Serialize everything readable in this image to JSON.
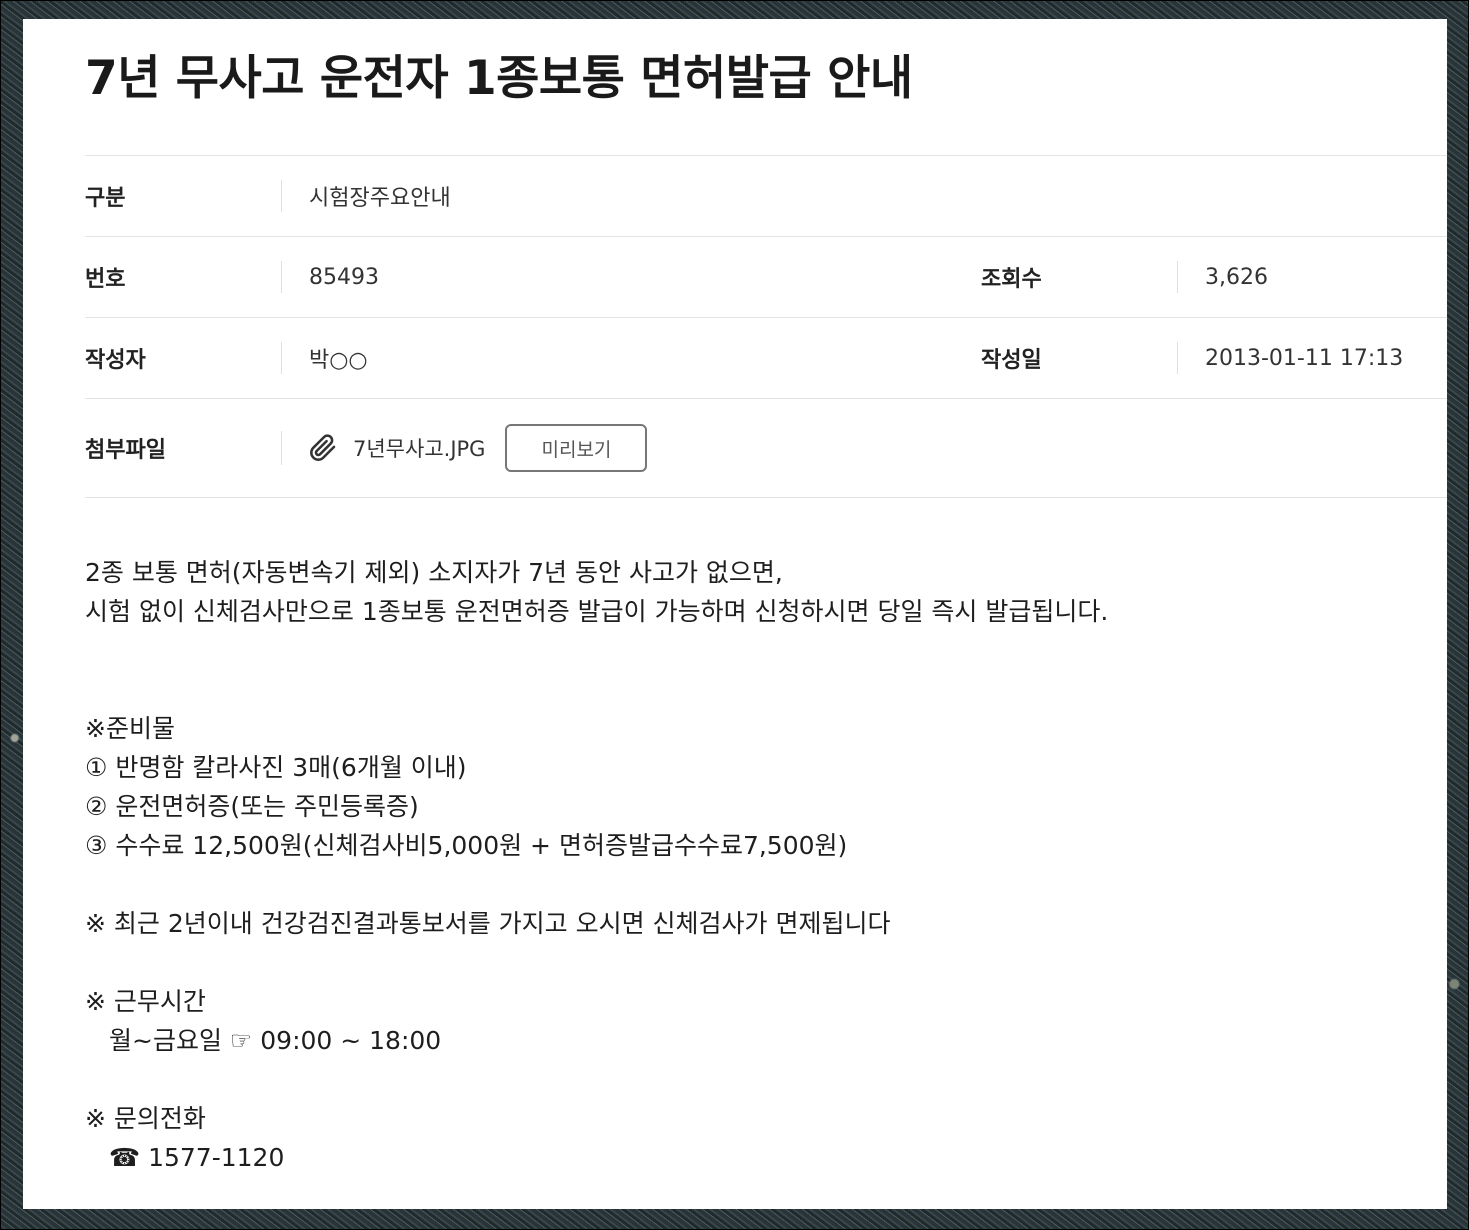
{
  "post": {
    "title": "7년 무사고 운전자 1종보통 면허발급 안내"
  },
  "meta": {
    "category": {
      "label": "구분",
      "value": "시험장주요안내"
    },
    "number": {
      "label": "번호",
      "value": "85493"
    },
    "views": {
      "label": "조회수",
      "value": "3,626"
    },
    "author": {
      "label": "작성자",
      "value": "박○○"
    },
    "date": {
      "label": "작성일",
      "value": "2013-01-11 17:13"
    },
    "attachment": {
      "label": "첨부파일",
      "file_name": "7년무사고.JPG",
      "preview_label": "미리보기",
      "icon": "paperclip-icon"
    }
  },
  "content": {
    "intro_line1": "2종 보통 면허(자동변속기 제외) 소지자가 7년 동안 사고가 없으면,",
    "intro_line2": "시험 없이 신체검사만으로 1종보통 운전면허증 발급이 가능하며 신청하시면 당일 즉시 발급됩니다.",
    "prep_heading": "※준비물",
    "prep_items": [
      "① 반명함 칼라사진 3매(6개월 이내)",
      "② 운전면허증(또는 주민등록증)",
      "③ 수수료 12,500원(신체검사비5,000원 + 면허증발급수수료7,500원)"
    ],
    "exemption_note": "※ 최근 2년이내 건강검진결과통보서를 가지고 오시면 신체검사가 면제됩니다",
    "hours_heading": "※ 근무시간",
    "hours_value": "월~금요일 ☞ 09:00 ~ 18:00",
    "phone_heading": "※ 문의전화",
    "phone_value": "☎ 1577-1120"
  }
}
